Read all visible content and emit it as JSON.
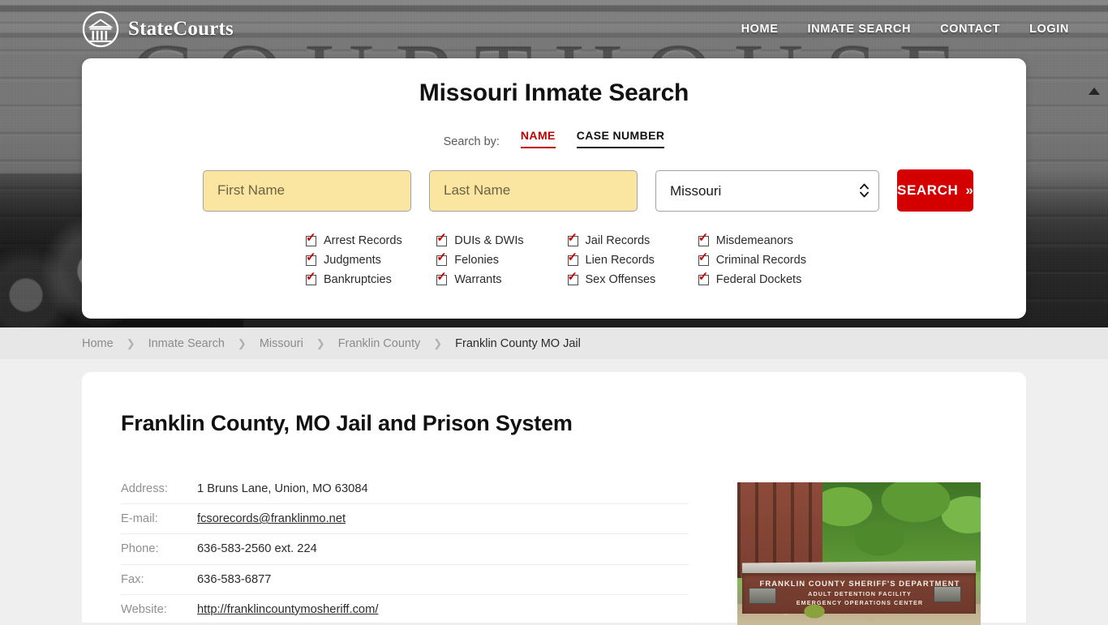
{
  "brand": {
    "name": "StateCourts",
    "logo_icon": "courthouse-pillars-icon"
  },
  "nav": {
    "items": [
      {
        "label": "HOME"
      },
      {
        "label": "INMATE SEARCH"
      },
      {
        "label": "CONTACT"
      },
      {
        "label": "LOGIN"
      }
    ]
  },
  "search_card": {
    "title": "Missouri Inmate Search",
    "search_by_label": "Search by:",
    "tabs": [
      {
        "label": "NAME",
        "active": true
      },
      {
        "label": "CASE NUMBER",
        "active": false
      }
    ],
    "first_name": {
      "placeholder": "First Name",
      "value": ""
    },
    "last_name": {
      "placeholder": "Last Name",
      "value": ""
    },
    "state": {
      "selected": "Missouri"
    },
    "search_button": {
      "label": "SEARCH",
      "chevron": "»"
    },
    "accent_red": "#c00000",
    "button_red": "#d40000",
    "field_yellow": "#fae6a0",
    "record_types": [
      "Arrest Records",
      "DUIs & DWIs",
      "Jail Records",
      "Misdemeanors",
      "Judgments",
      "Felonies",
      "Lien Records",
      "Criminal Records",
      "Bankruptcies",
      "Warrants",
      "Sex Offenses",
      "Federal Dockets"
    ]
  },
  "breadcrumb": {
    "separator": "❯",
    "items": [
      {
        "label": "Home",
        "current": false
      },
      {
        "label": "Inmate Search",
        "current": false
      },
      {
        "label": "Missouri",
        "current": false
      },
      {
        "label": "Franklin County",
        "current": false
      },
      {
        "label": "Franklin County MO Jail",
        "current": true
      }
    ]
  },
  "content": {
    "page_title": "Franklin County, MO Jail and Prison System",
    "details": [
      {
        "key": "Address:",
        "value": "1 Bruns Lane, Union, MO 63084",
        "link": false
      },
      {
        "key": "E-mail:",
        "value": "fcsorecords@franklinmo.net",
        "link": true
      },
      {
        "key": "Phone:",
        "value": "636-583-2560 ext. 224",
        "link": false
      },
      {
        "key": "Fax:",
        "value": "636-583-6877",
        "link": false
      },
      {
        "key": "Website:",
        "value": "http://franklincountymosheriff.com/",
        "link": true
      }
    ],
    "photo": {
      "alt": "franklin-county-sheriff-sign-photo",
      "sign_line1": "FRANKLIN COUNTY SHERIFF'S DEPARTMENT",
      "sign_line2": "ADULT DETENTION FACILITY",
      "sign_line3": "EMERGENCY OPERATIONS CENTER"
    }
  },
  "hero": {
    "background_word": "COURTHOUSE"
  }
}
